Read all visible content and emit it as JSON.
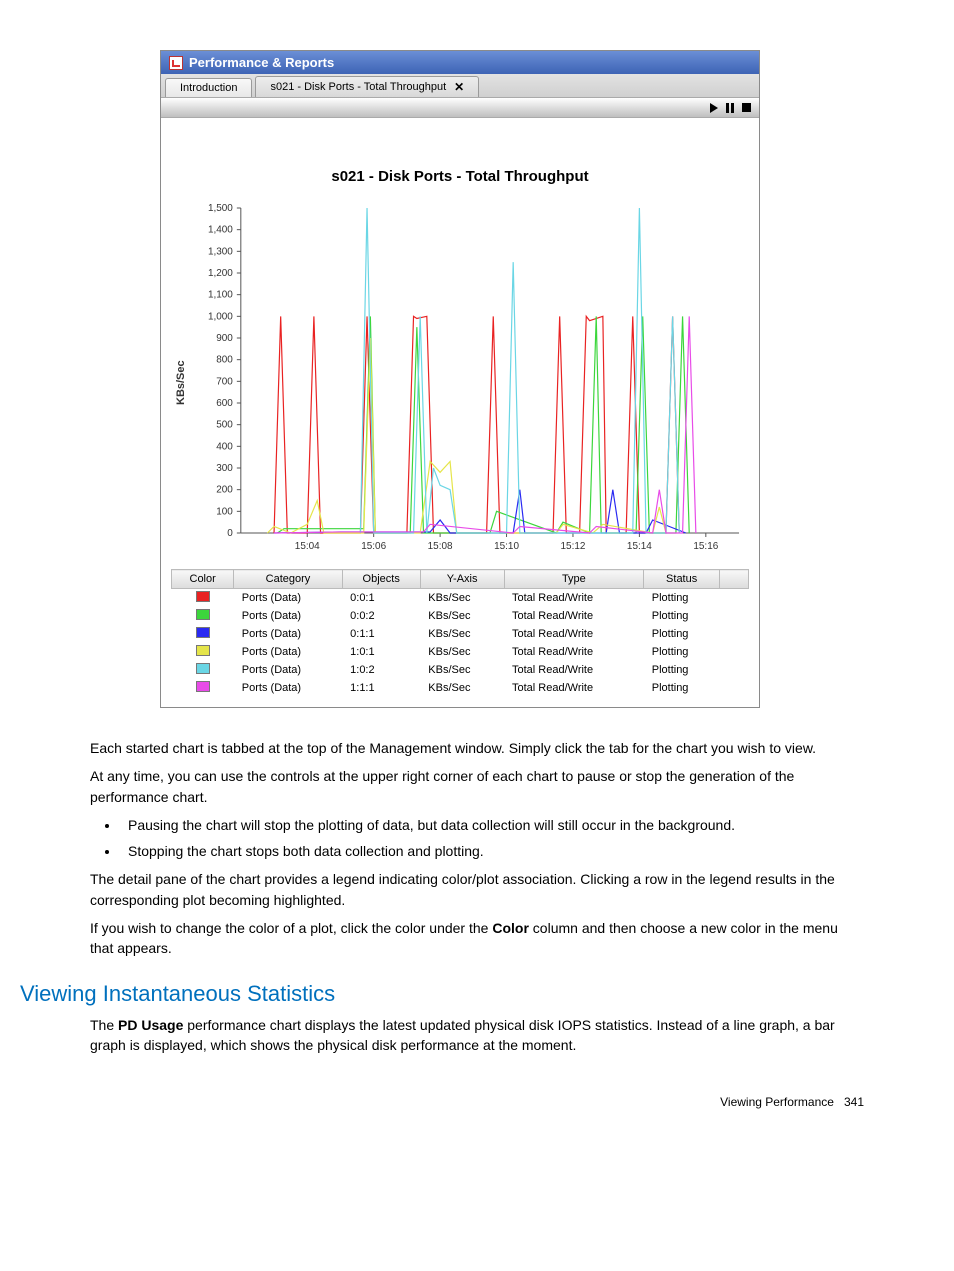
{
  "window_title": "Performance & Reports",
  "tabs": [
    {
      "label": "Introduction",
      "closable": false
    },
    {
      "label": "s021 - Disk Ports - Total Throughput",
      "closable": true
    }
  ],
  "chart_title": "s021 - Disk Ports - Total Throughput",
  "ylabel": "KBs/Sec",
  "legend_headers": [
    "Color",
    "Category",
    "Objects",
    "Y-Axis",
    "Type",
    "Status"
  ],
  "legend_rows": [
    {
      "color": "#e92222",
      "category": "Ports (Data)",
      "objects": "0:0:1",
      "yaxis": "KBs/Sec",
      "type": "Total Read/Write",
      "status": "Plotting"
    },
    {
      "color": "#3cd63c",
      "category": "Ports (Data)",
      "objects": "0:0:2",
      "yaxis": "KBs/Sec",
      "type": "Total Read/Write",
      "status": "Plotting"
    },
    {
      "color": "#2a2af2",
      "category": "Ports (Data)",
      "objects": "0:1:1",
      "yaxis": "KBs/Sec",
      "type": "Total Read/Write",
      "status": "Plotting"
    },
    {
      "color": "#e5e54a",
      "category": "Ports (Data)",
      "objects": "1:0:1",
      "yaxis": "KBs/Sec",
      "type": "Total Read/Write",
      "status": "Plotting"
    },
    {
      "color": "#6ad6e5",
      "category": "Ports (Data)",
      "objects": "1:0:2",
      "yaxis": "KBs/Sec",
      "type": "Total Read/Write",
      "status": "Plotting"
    },
    {
      "color": "#e84be8",
      "category": "Ports (Data)",
      "objects": "1:1:1",
      "yaxis": "KBs/Sec",
      "type": "Total Read/Write",
      "status": "Plotting"
    }
  ],
  "chart_data": {
    "type": "line",
    "title": "s021 - Disk Ports - Total Throughput",
    "ylabel": "KBs/Sec",
    "xlabel": "",
    "ylim": [
      0,
      1500
    ],
    "x_ticks": [
      "15:04",
      "15:06",
      "15:08",
      "15:10",
      "15:12",
      "15:14",
      "15:16"
    ],
    "y_ticks": [
      0,
      100,
      200,
      300,
      400,
      500,
      600,
      700,
      800,
      900,
      1000,
      1100,
      1200,
      1300,
      1400,
      1500
    ],
    "x_range_minutes": [
      902,
      917
    ],
    "series": [
      {
        "name": "0:0:1",
        "color": "#e92222",
        "points": [
          [
            903.0,
            0
          ],
          [
            903.2,
            1000
          ],
          [
            903.4,
            0
          ],
          [
            904.0,
            0
          ],
          [
            904.2,
            1000
          ],
          [
            904.4,
            0
          ],
          [
            905.6,
            0
          ],
          [
            905.8,
            1000
          ],
          [
            906.0,
            0
          ],
          [
            907.0,
            0
          ],
          [
            907.2,
            1000
          ],
          [
            907.3,
            990
          ],
          [
            907.6,
            1000
          ],
          [
            907.8,
            0
          ],
          [
            909.4,
            0
          ],
          [
            909.6,
            1000
          ],
          [
            909.8,
            0
          ],
          [
            911.4,
            0
          ],
          [
            911.6,
            1000
          ],
          [
            911.8,
            0
          ],
          [
            912.2,
            0
          ],
          [
            912.4,
            1000
          ],
          [
            912.5,
            980
          ],
          [
            912.9,
            1000
          ],
          [
            913.0,
            0
          ],
          [
            913.6,
            0
          ],
          [
            913.8,
            1000
          ],
          [
            914.0,
            0
          ],
          [
            914.8,
            0
          ],
          [
            915.0,
            1000
          ],
          [
            915.2,
            0
          ]
        ]
      },
      {
        "name": "0:0:2",
        "color": "#3cd63c",
        "points": [
          [
            903.1,
            0
          ],
          [
            903.3,
            20
          ],
          [
            905.7,
            20
          ],
          [
            905.9,
            1000
          ],
          [
            906.05,
            0
          ],
          [
            907.1,
            0
          ],
          [
            907.3,
            950
          ],
          [
            907.5,
            0
          ],
          [
            909.5,
            0
          ],
          [
            909.7,
            100
          ],
          [
            911.5,
            0
          ],
          [
            911.7,
            50
          ],
          [
            912.5,
            0
          ],
          [
            912.7,
            1000
          ],
          [
            912.85,
            0
          ],
          [
            913.9,
            0
          ],
          [
            914.1,
            1000
          ],
          [
            914.3,
            0
          ],
          [
            915.1,
            0
          ],
          [
            915.3,
            1000
          ],
          [
            915.5,
            0
          ]
        ]
      },
      {
        "name": "0:1:1",
        "color": "#2a2af2",
        "points": [
          [
            903.0,
            0
          ],
          [
            905.0,
            5
          ],
          [
            907.7,
            5
          ],
          [
            908.0,
            60
          ],
          [
            908.3,
            0
          ],
          [
            910.2,
            0
          ],
          [
            910.4,
            200
          ],
          [
            910.55,
            0
          ],
          [
            913.0,
            0
          ],
          [
            913.2,
            200
          ],
          [
            913.4,
            0
          ],
          [
            914.2,
            0
          ],
          [
            914.4,
            60
          ],
          [
            915.4,
            0
          ]
        ]
      },
      {
        "name": "1:0:1",
        "color": "#e5e54a",
        "points": [
          [
            902.8,
            0
          ],
          [
            903.0,
            30
          ],
          [
            903.5,
            0
          ],
          [
            904.0,
            40
          ],
          [
            904.3,
            150
          ],
          [
            904.5,
            0
          ],
          [
            905.7,
            0
          ],
          [
            905.9,
            900
          ],
          [
            906.05,
            0
          ],
          [
            907.4,
            0
          ],
          [
            907.7,
            330
          ],
          [
            908.0,
            280
          ],
          [
            908.3,
            330
          ],
          [
            908.5,
            0
          ],
          [
            911.5,
            0
          ],
          [
            911.7,
            40
          ],
          [
            912.6,
            0
          ],
          [
            912.9,
            40
          ],
          [
            914.4,
            0
          ],
          [
            914.6,
            120
          ],
          [
            914.8,
            0
          ]
        ]
      },
      {
        "name": "1:0:2",
        "color": "#6ad6e5",
        "points": [
          [
            905.6,
            0
          ],
          [
            905.8,
            1500
          ],
          [
            906.0,
            0
          ],
          [
            907.2,
            0
          ],
          [
            907.4,
            1000
          ],
          [
            907.6,
            0
          ],
          [
            907.8,
            300
          ],
          [
            908.0,
            220
          ],
          [
            908.3,
            200
          ],
          [
            908.5,
            0
          ],
          [
            910.0,
            0
          ],
          [
            910.2,
            1250
          ],
          [
            910.4,
            0
          ],
          [
            913.8,
            0
          ],
          [
            914.0,
            1500
          ],
          [
            914.2,
            0
          ],
          [
            914.8,
            0
          ],
          [
            915.0,
            1000
          ],
          [
            915.2,
            0
          ]
        ]
      },
      {
        "name": "1:1:1",
        "color": "#e84be8",
        "points": [
          [
            903.0,
            0
          ],
          [
            905.0,
            5
          ],
          [
            907.5,
            5
          ],
          [
            907.7,
            40
          ],
          [
            910.2,
            0
          ],
          [
            910.4,
            30
          ],
          [
            912.5,
            0
          ],
          [
            912.7,
            30
          ],
          [
            914.4,
            0
          ],
          [
            914.6,
            200
          ],
          [
            914.8,
            0
          ],
          [
            915.3,
            0
          ],
          [
            915.5,
            1000
          ],
          [
            915.7,
            0
          ]
        ]
      }
    ]
  },
  "body": {
    "p1": "Each started chart is tabbed at the top of the Management window. Simply click the tab for the chart you wish to view.",
    "p2": "At any time, you can use the controls at the upper right corner of each chart to pause or stop the generation of the performance chart.",
    "li1": "Pausing the chart will stop the plotting of data, but data collection will still occur in the background.",
    "li2": "Stopping the chart stops both data collection and plotting.",
    "p3": "The detail pane of the chart provides a legend indicating color/plot association. Clicking a row in the legend results in the corresponding plot becoming highlighted.",
    "p4_a": "If you wish to change the color of a plot, click the color under the ",
    "p4_bold": "Color",
    "p4_b": " column and then choose a new color in the menu that appears."
  },
  "heading": "Viewing Instantaneous Statistics",
  "section_p_a": "The ",
  "section_p_bold": "PD Usage",
  "section_p_b": " performance chart displays the latest updated physical disk IOPS statistics. Instead of a line graph, a bar graph is displayed, which shows the physical disk performance at the moment.",
  "footer_label": "Viewing Performance",
  "footer_page": "341"
}
